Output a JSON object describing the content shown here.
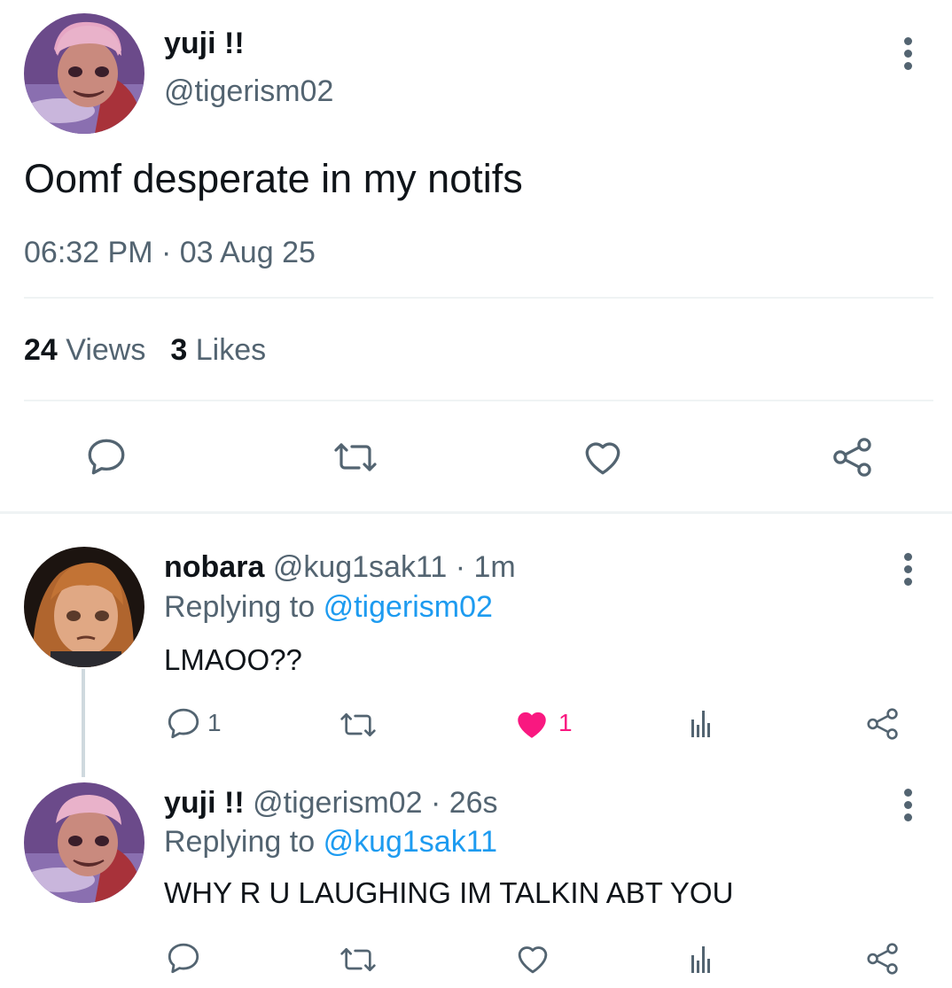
{
  "main_tweet": {
    "author_name": "yuji !!",
    "author_handle": "@tigerism02",
    "text": "Oomf desperate in my notifs",
    "timestamp": "06:32 PM · 03 Aug 25",
    "views_count": "24",
    "views_label": "Views",
    "likes_count": "3",
    "likes_label": "Likes"
  },
  "replies": [
    {
      "author_name": "nobara",
      "author_handle": "@kug1sak11",
      "time": "· 1m",
      "replying_label": "Replying to",
      "replying_to": "@tigerism02",
      "text": "LMAOO??",
      "reply_count": "1",
      "like_count": "1",
      "liked": true
    },
    {
      "author_name": "yuji !!",
      "author_handle": "@tigerism02",
      "time": "· 26s",
      "replying_label": "Replying to",
      "replying_to": "@kug1sak11",
      "text": "WHY R U LAUGHING IM TALKIN ABT YOU",
      "reply_count": "",
      "like_count": "",
      "liked": false
    }
  ],
  "colors": {
    "text_primary": "#0f1419",
    "text_secondary": "#536471",
    "link": "#1d9bf0",
    "like_active": "#f91880",
    "divider": "#eff3f4"
  },
  "icons": [
    "avatar",
    "more-options-icon",
    "reply-icon",
    "retweet-icon",
    "like-icon",
    "share-icon",
    "analytics-icon"
  ]
}
